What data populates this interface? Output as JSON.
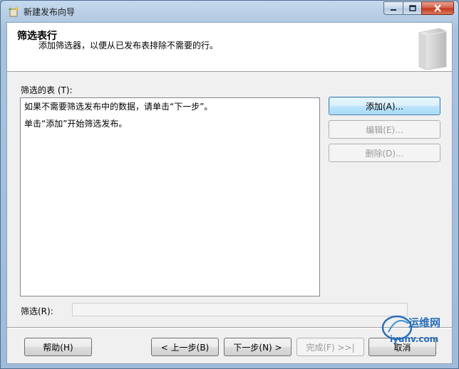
{
  "window": {
    "title": "新建发布向导"
  },
  "header": {
    "title": "筛选表行",
    "subtitle": "添加筛选器，以便从已发布表排除不需要的行。"
  },
  "filtered_tables": {
    "label": "筛选的表 (T):",
    "lines": [
      "如果不需要筛选发布中的数据，请单击“下一步”。",
      "单击“添加”开始筛选发布。"
    ]
  },
  "side_buttons": {
    "add": "添加(A)...",
    "edit": "编辑(E)...",
    "delete": "删除(D)..."
  },
  "filter": {
    "label": "筛选(R):",
    "value": ""
  },
  "footer": {
    "help": "帮助(H)",
    "back": "< 上一步(B)",
    "next": "下一步(N) >",
    "finish": "完成(F) >>|",
    "cancel": "取消"
  },
  "watermark": {
    "text_cn": "运维网",
    "text_en": "iyunv.com"
  },
  "colors": {
    "title_gradient_top": "#c6d9ee",
    "close_button": "#c3361d",
    "focus_button_border": "#3c7fb1",
    "disabled_text": "#9a9a9a"
  }
}
